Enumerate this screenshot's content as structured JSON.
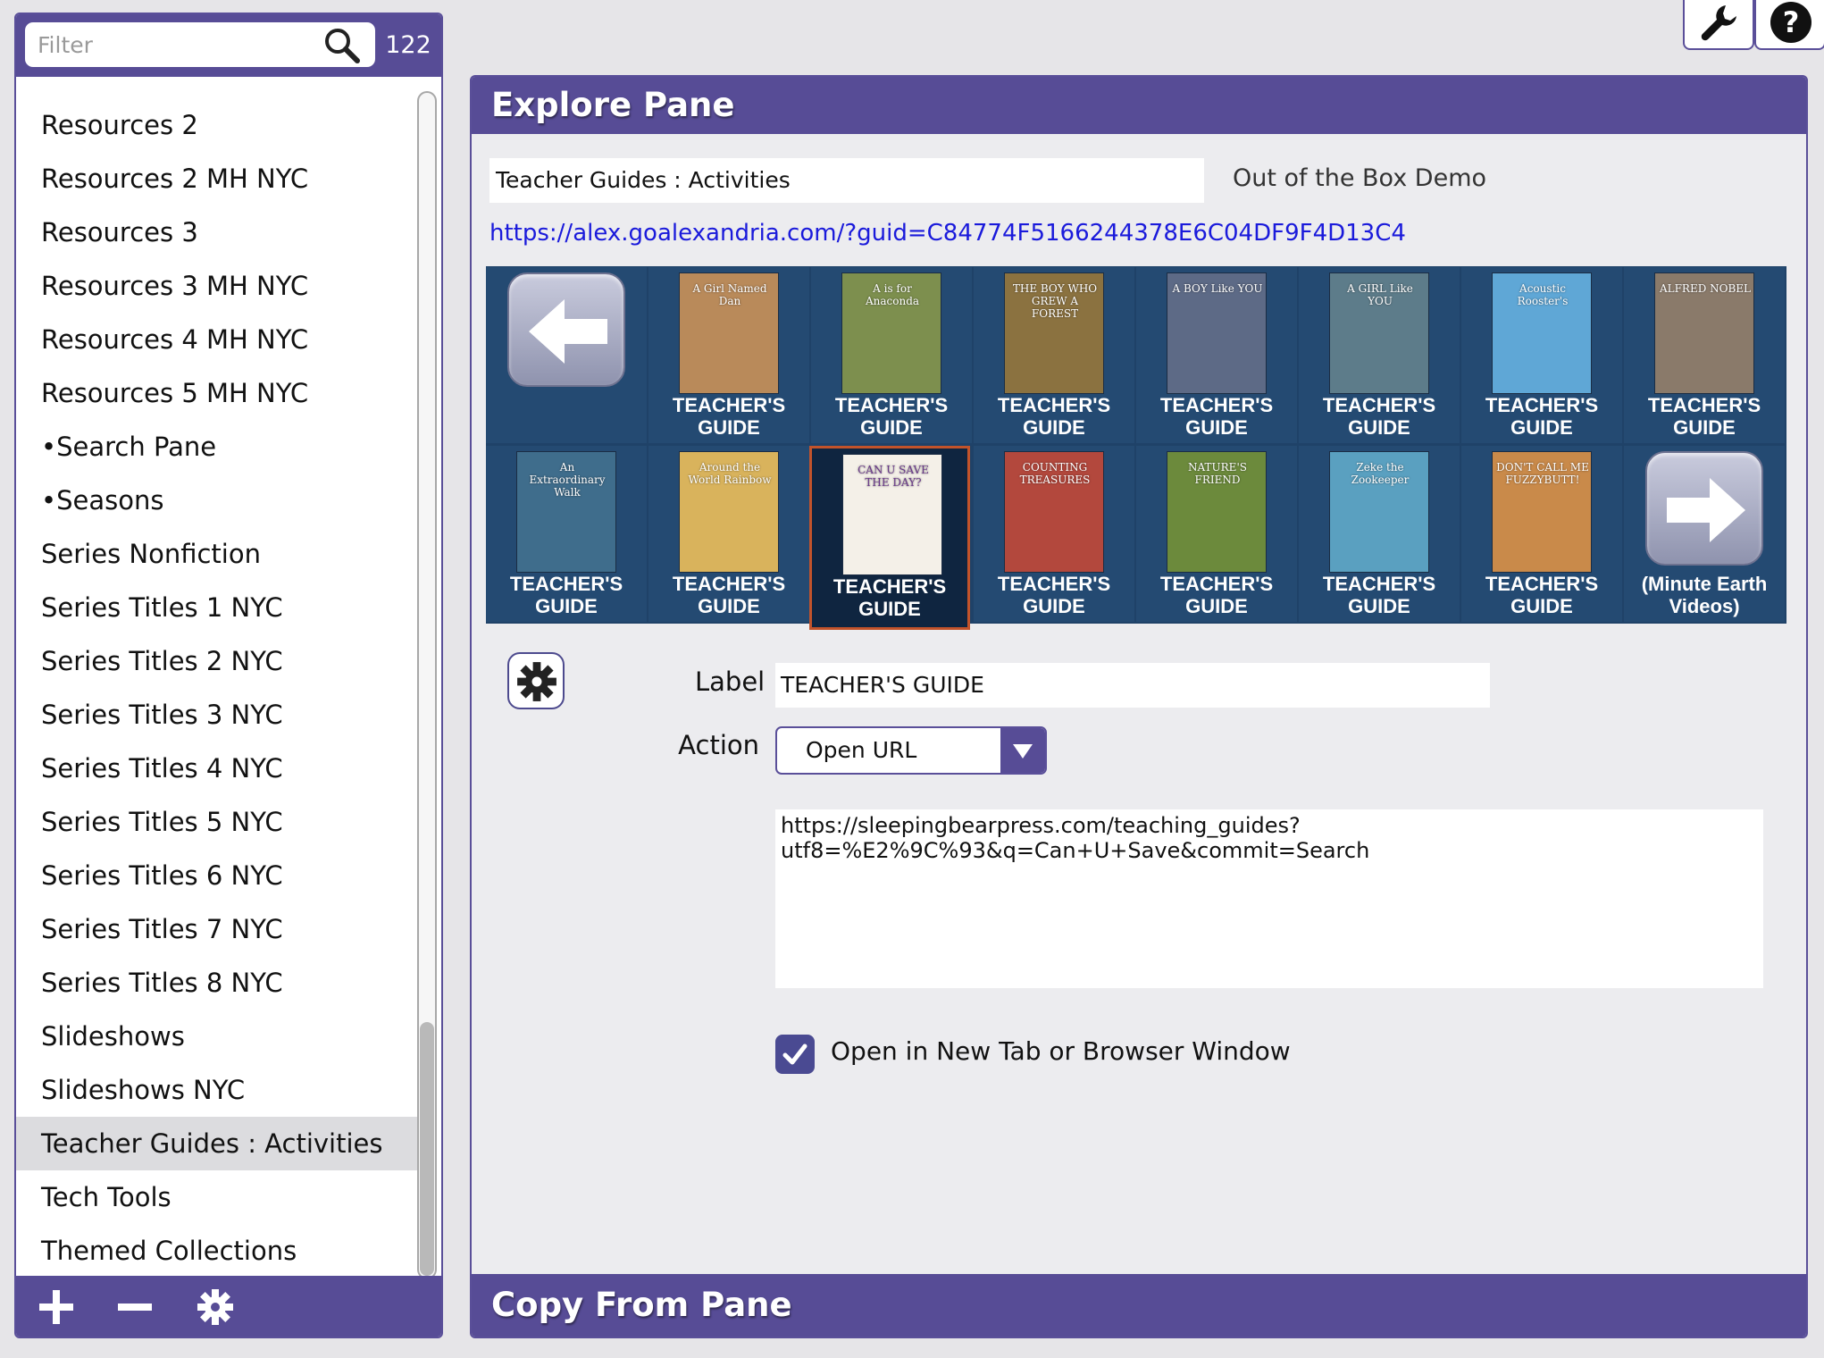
{
  "filter": {
    "placeholder": "Filter",
    "count": "122"
  },
  "list": {
    "items": [
      "Resources 2",
      "Resources 2 MH NYC",
      "Resources 3",
      "Resources 3 MH NYC",
      "Resources 4 MH NYC",
      "Resources 5 MH NYC",
      "•Search Pane",
      "•Seasons",
      "Series Nonfiction",
      "Series Titles 1 NYC",
      "Series Titles 2 NYC",
      "Series Titles 3 NYC",
      "Series Titles 4 NYC",
      "Series Titles 5 NYC",
      "Series Titles 6 NYC",
      "Series Titles 7 NYC",
      "Series Titles 8 NYC",
      "Slideshows",
      "Slideshows NYC",
      "Teacher Guides : Activities",
      "Tech Tools",
      "Themed Collections"
    ],
    "selected": "Teacher Guides : Activities"
  },
  "footer_icons": [
    "plus-icon",
    "minus-icon",
    "gear-icon"
  ],
  "toolbar_icons": [
    "wrench-icon",
    "help-icon"
  ],
  "explore": {
    "title": "Explore Pane",
    "path": "Teacher Guides : Activities",
    "demo": "Out of the Box Demo",
    "url": "https://alex.goalexandria.com/?guid=C84774F5166244378E6C04DF9F4D13C4"
  },
  "tiles": {
    "row1": [
      {
        "label": "",
        "type": "back-arrow"
      },
      {
        "label_line1": "TEACHER'S",
        "label_line2": "GUIDE",
        "cover_title": "A Girl Named Dan",
        "color": "#b98a5a"
      },
      {
        "label_line1": "TEACHER'S",
        "label_line2": "GUIDE",
        "cover_title": "A is for Anaconda",
        "color": "#7d8f4e"
      },
      {
        "label_line1": "TEACHER'S",
        "label_line2": "GUIDE",
        "cover_title": "THE BOY WHO GREW A FOREST",
        "color": "#8b7240"
      },
      {
        "label_line1": "TEACHER'S",
        "label_line2": "GUIDE",
        "cover_title": "A BOY Like YOU",
        "color": "#5d6a86"
      },
      {
        "label_line1": "TEACHER'S",
        "label_line2": "GUIDE",
        "cover_title": "A GIRL Like YOU",
        "color": "#5d7c8a"
      },
      {
        "label_line1": "TEACHER'S",
        "label_line2": "GUIDE",
        "cover_title": "Acoustic Rooster's",
        "color": "#5fa7d6"
      },
      {
        "label_line1": "TEACHER'S",
        "label_line2": "GUIDE",
        "cover_title": "ALFRED NOBEL",
        "color": "#8a7a6a"
      }
    ],
    "row2": [
      {
        "label_line1": "TEACHER'S",
        "label_line2": "GUIDE",
        "cover_title": "An Extraordinary Walk",
        "color": "#3f6d8c"
      },
      {
        "label_line1": "TEACHER'S",
        "label_line2": "GUIDE",
        "cover_title": "Around the World Rainbow",
        "color": "#d9b35c"
      },
      {
        "label_line1": "TEACHER'S",
        "label_line2": "GUIDE",
        "cover_title": "CAN U SAVE THE DAY?",
        "color": "#f4f0e8",
        "selected": true
      },
      {
        "label_line1": "TEACHER'S",
        "label_line2": "GUIDE",
        "cover_title": "COUNTING TREASURES",
        "color": "#b3483d"
      },
      {
        "label_line1": "TEACHER'S",
        "label_line2": "GUIDE",
        "cover_title": "NATURE'S FRIEND",
        "color": "#6c8a3c"
      },
      {
        "label_line1": "TEACHER'S",
        "label_line2": "GUIDE",
        "cover_title": "Zeke the Zookeeper",
        "color": "#5aa0c0"
      },
      {
        "label_line1": "TEACHER'S",
        "label_line2": "GUIDE",
        "cover_title": "DON'T CALL ME FUZZYBUTT!",
        "color": "#c98a4a"
      },
      {
        "label_line1": "(Minute Earth",
        "label_line2": "Videos)",
        "type": "forward-arrow"
      }
    ]
  },
  "detail": {
    "label_caption": "Label",
    "label_value": "TEACHER'S GUIDE",
    "action_caption": "Action",
    "action_value": "Open URL",
    "url_value": "https://sleepingbearpress.com/teaching_guides?\nutf8=%E2%9C%93&q=Can+U+Save&commit=Search",
    "new_tab_label": "Open in New Tab or Browser Window",
    "new_tab_checked": true
  },
  "copy_pane": {
    "title": "Copy From Pane"
  },
  "colors": {
    "accent": "#574c96",
    "tile_bg": "#244a72",
    "link": "#1a1adb",
    "selected_border": "#c2532b"
  }
}
